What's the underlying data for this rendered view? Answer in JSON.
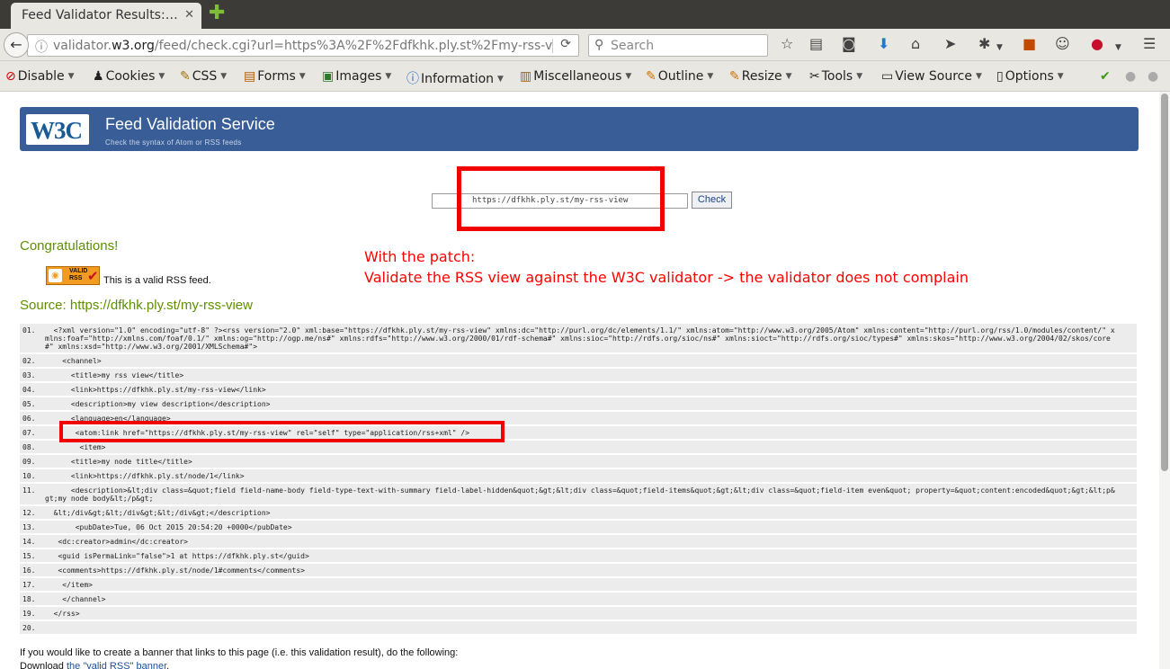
{
  "browser": {
    "tab_title": "Feed Validator Results:…",
    "tab_close": "✕",
    "new_tab": "✚",
    "back": "←",
    "url_prefix": "validator.",
    "url_domain": "w3.org",
    "url_rest": "/feed/check.cgi?url=https%3A%2F%2Fdfkhk.ply.st%2Fmy-rss-v",
    "reload": "⟳",
    "search_placeholder": "Search"
  },
  "devbar": {
    "items": [
      {
        "icon": "⊘",
        "label": "Disable"
      },
      {
        "icon": "♟",
        "label": "Cookies"
      },
      {
        "icon": "✎",
        "label": "CSS"
      },
      {
        "icon": "▤",
        "label": "Forms"
      },
      {
        "icon": "▣",
        "label": "Images"
      },
      {
        "icon": "ⓘ",
        "label": "Information"
      },
      {
        "icon": "▥",
        "label": "Miscellaneous"
      },
      {
        "icon": "✎",
        "label": "Outline"
      },
      {
        "icon": "✎",
        "label": "Resize"
      },
      {
        "icon": "✂",
        "label": "Tools"
      },
      {
        "icon": "▭",
        "label": "View Source"
      },
      {
        "icon": "▯",
        "label": "Options"
      }
    ],
    "arrow": "▼"
  },
  "page": {
    "banner_title": "Feed Validation Service",
    "banner_subtitle": "Check the syntax of Atom or RSS feeds",
    "logo_text": "W3C",
    "input_value": "https://dfkhk.ply.st/my-rss-view",
    "check_label": "Check",
    "congrats": "Congratulations!",
    "badge_label_1": "VALID",
    "badge_label_2": "RSS",
    "valid_text": "This is a valid RSS feed.",
    "source": "Source: https://dfkhk.ply.st/my-rss-view",
    "footer_line_1": "If you would like to create a banner that links to this page (i.e. this validation result), do the following:",
    "footer_download": "Download ",
    "footer_link": "the \"valid RSS\" banner",
    "footer_period": "."
  },
  "annotation": {
    "line1": "With the patch:",
    "line2": "Validate the RSS view against the W3C validator -> the validator does not complain"
  },
  "code_lines": [
    {
      "n": "01.",
      "text": "  <?xml version=\"1.0\" encoding=\"utf-8\" ?><rss version=\"2.0\" xml:base=\"https://dfkhk.ply.st/my-rss-view\" xmlns:dc=\"http://purl.org/dc/elements/1.1/\" xmlns:atom=\"http://www.w3.org/2005/Atom\" xmlns:content=\"http://purl.org/rss/1.0/modules/content/\" xmlns:foaf=\"http://xmlns.com/foaf/0.1/\" xmlns:og=\"http://ogp.me/ns#\" xmlns:rdfs=\"http://www.w3.org/2000/01/rdf-schema#\" xmlns:sioc=\"http://rdfs.org/sioc/ns#\" xmlns:sioct=\"http://rdfs.org/sioc/types#\" xmlns:skos=\"http://www.w3.org/2004/02/skos/core#\" xmlns:xsd=\"http://www.w3.org/2001/XMLSchema#\">"
    },
    {
      "n": "02.",
      "text": "    <channel>"
    },
    {
      "n": "03.",
      "text": "      <title>my rss view</title>"
    },
    {
      "n": "04.",
      "text": "      <link>https://dfkhk.ply.st/my-rss-view</link>"
    },
    {
      "n": "05.",
      "text": "      <description>my view description</description>"
    },
    {
      "n": "06.",
      "text": "      <language>en</language>"
    },
    {
      "n": "07.",
      "text": "       <atom:link href=\"https://dfkhk.ply.st/my-rss-view\" rel=\"self\" type=\"application/rss+xml\" />"
    },
    {
      "n": "08.",
      "text": "        <item>"
    },
    {
      "n": "09.",
      "text": "      <title>my node title</title>"
    },
    {
      "n": "10.",
      "text": "      <link>https://dfkhk.ply.st/node/1</link>"
    },
    {
      "n": "11.",
      "text": "      <description>&lt;div class=&quot;field field-name-body field-type-text-with-summary field-label-hidden&quot;&gt;&lt;div class=&quot;field-items&quot;&gt;&lt;div class=&quot;field-item even&quot; property=&quot;content:encoded&quot;&gt;&lt;p&gt;my node body&lt;/p&gt;"
    },
    {
      "n": "12.",
      "text": "  &lt;/div&gt;&lt;/div&gt;&lt;/div&gt;</description>"
    },
    {
      "n": "13.",
      "text": "       <pubDate>Tue, 06 Oct 2015 20:54:20 +0000</pubDate>"
    },
    {
      "n": "14.",
      "text": "   <dc:creator>admin</dc:creator>"
    },
    {
      "n": "15.",
      "text": "   <guid isPermaLink=\"false\">1 at https://dfkhk.ply.st</guid>"
    },
    {
      "n": "16.",
      "text": "   <comments>https://dfkhk.ply.st/node/1#comments</comments>"
    },
    {
      "n": "17.",
      "text": "    </item>"
    },
    {
      "n": "18.",
      "text": "    </channel>"
    },
    {
      "n": "19.",
      "text": "  </rss>"
    },
    {
      "n": "20.",
      "text": ""
    }
  ]
}
